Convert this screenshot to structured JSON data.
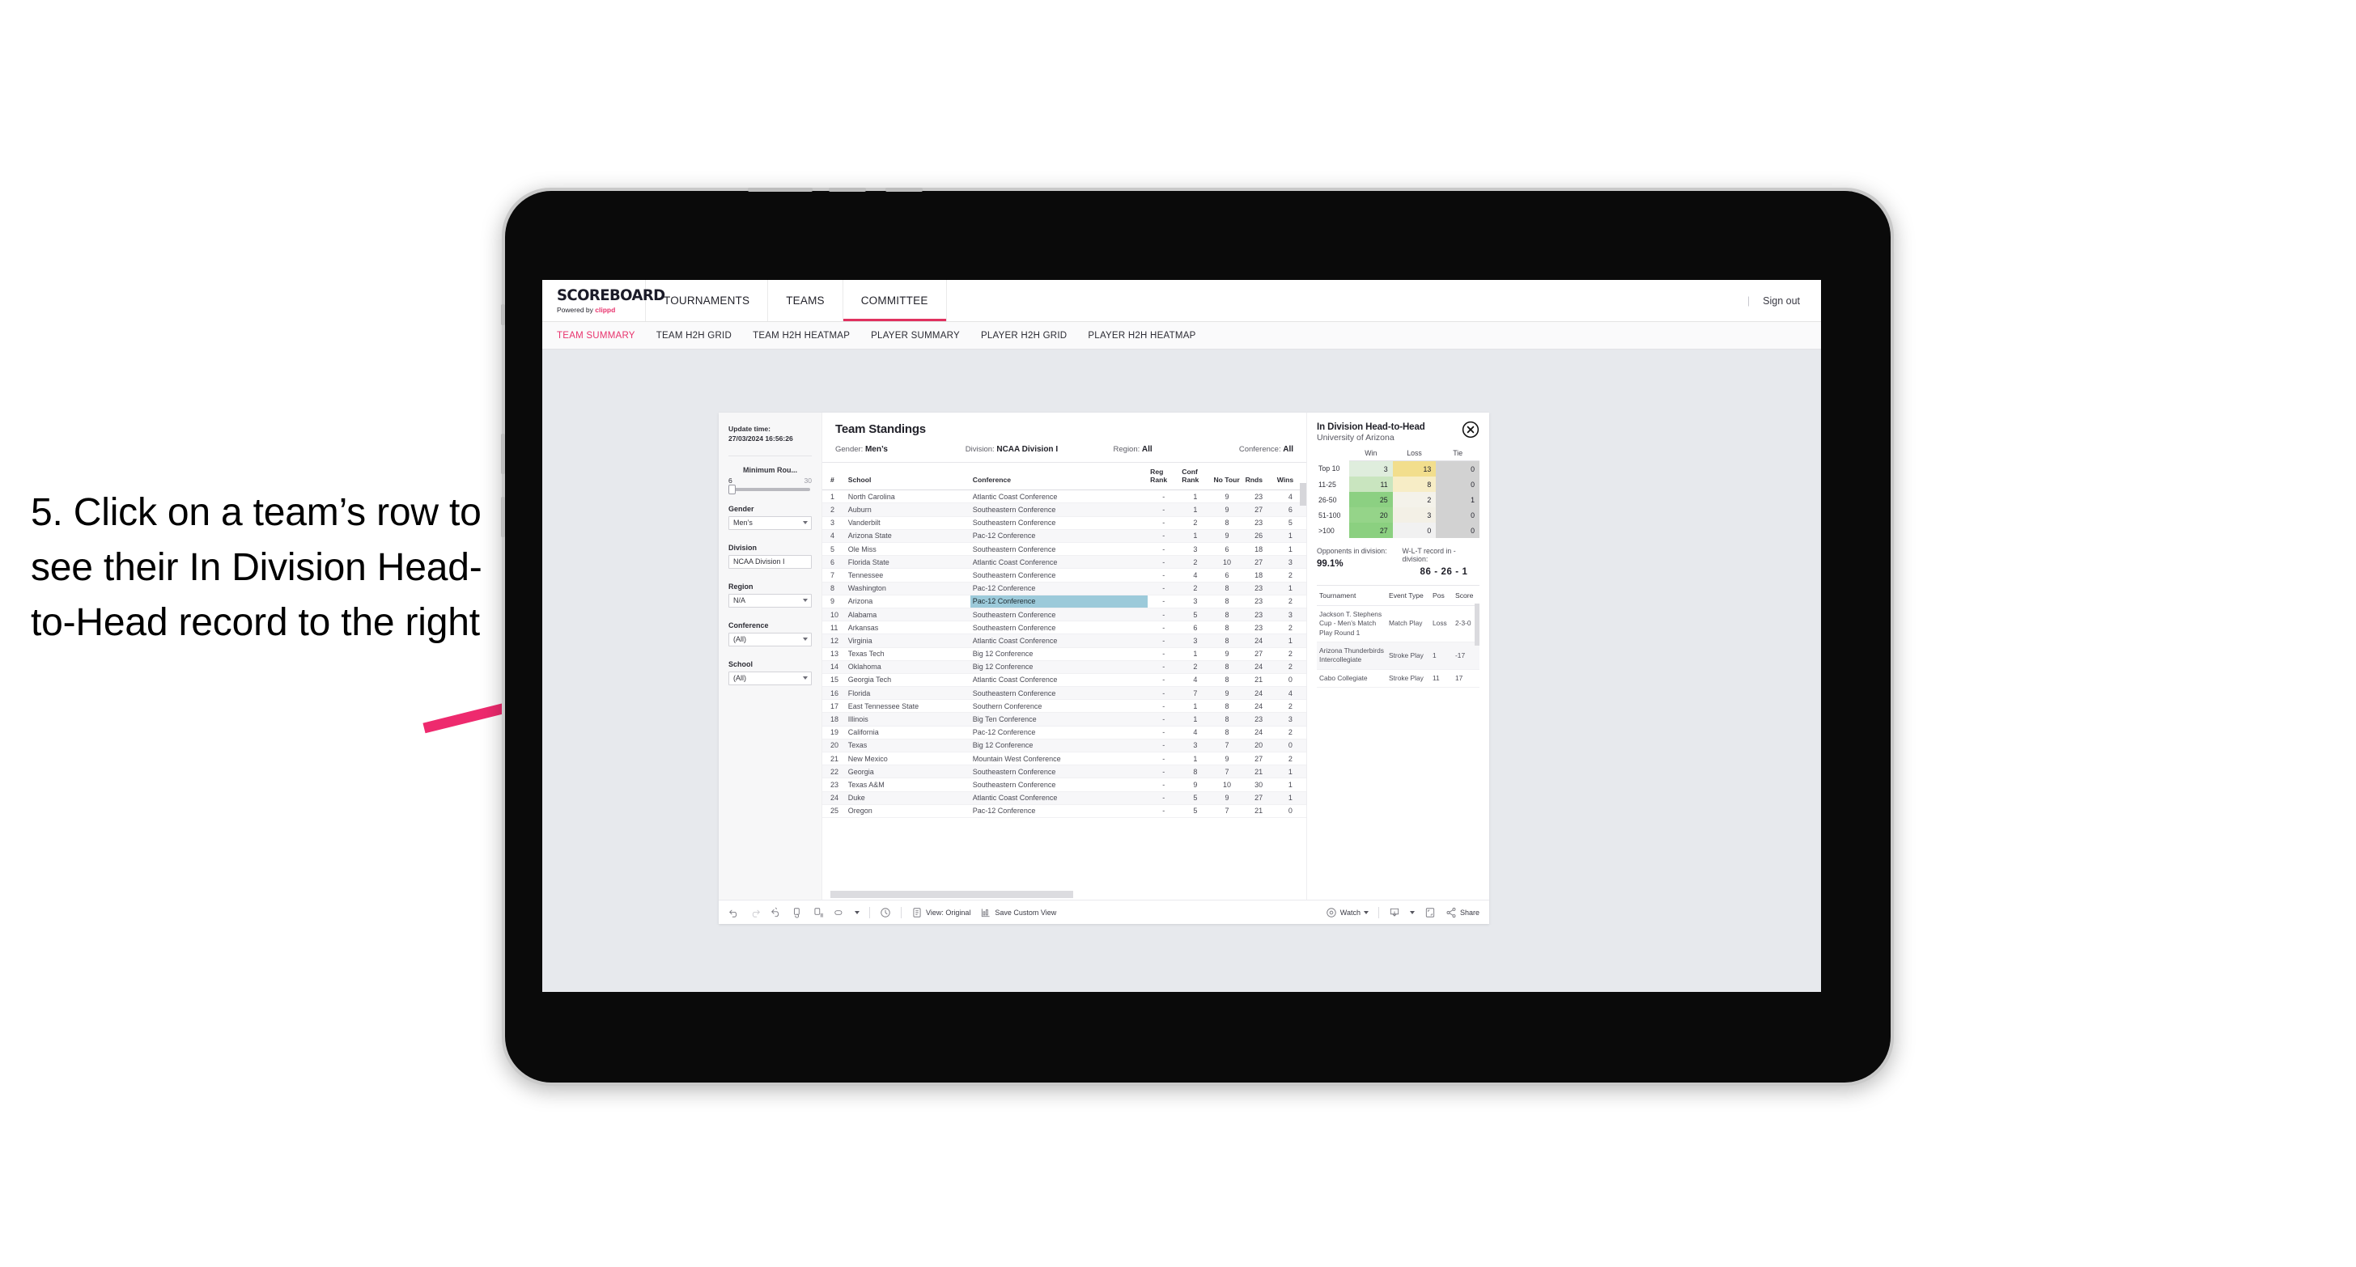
{
  "annotation": {
    "text": "5. Click on a team’s row to see their In Division Head-to-Head record to the right"
  },
  "app": {
    "brand": {
      "title": "SCOREBOARD",
      "powered_prefix": "Powered by ",
      "powered_name": "clippd"
    },
    "top_nav": [
      {
        "label": "TOURNAMENTS",
        "active": false
      },
      {
        "label": "TEAMS",
        "active": false
      },
      {
        "label": "COMMITTEE",
        "active": true
      }
    ],
    "sign_out": "Sign out",
    "divider": "|",
    "sub_tabs": [
      {
        "label": "TEAM SUMMARY",
        "active": true
      },
      {
        "label": "TEAM H2H GRID",
        "active": false
      },
      {
        "label": "TEAM H2H HEATMAP",
        "active": false
      },
      {
        "label": "PLAYER SUMMARY",
        "active": false
      },
      {
        "label": "PLAYER H2H GRID",
        "active": false
      },
      {
        "label": "PLAYER H2H HEATMAP",
        "active": false
      }
    ]
  },
  "filters": {
    "update_time_label": "Update time:",
    "update_time_value": "27/03/2024 16:56:26",
    "slider": {
      "label": "Minimum Rou...",
      "min": "6",
      "max": "30"
    },
    "selects": [
      {
        "label": "Gender",
        "value": "Men’s"
      },
      {
        "label": "Division",
        "value": "NCAA Division I"
      },
      {
        "label": "Region",
        "value": "N/A"
      },
      {
        "label": "Conference",
        "value": "(All)"
      },
      {
        "label": "School",
        "value": "(All)"
      }
    ]
  },
  "standings": {
    "title": "Team Standings",
    "meta": [
      {
        "label": "Gender: ",
        "value": "Men’s"
      },
      {
        "label": "Division: ",
        "value": "NCAA Division I"
      },
      {
        "label": "Region: ",
        "value": "All"
      },
      {
        "label": "Conference: ",
        "value": "All"
      }
    ],
    "columns": [
      "#",
      "School",
      "Conference",
      "Reg Rank",
      "Conf Rank",
      "No Tour",
      "Rnds",
      "Wins"
    ],
    "rows": [
      {
        "rank": "1",
        "school": "North Carolina",
        "conference": "Atlantic Coast Conference",
        "reg_rank": "-",
        "conf_rank": "1",
        "no_tour": "9",
        "rnds": "23",
        "wins": "4"
      },
      {
        "rank": "2",
        "school": "Auburn",
        "conference": "Southeastern Conference",
        "reg_rank": "-",
        "conf_rank": "1",
        "no_tour": "9",
        "rnds": "27",
        "wins": "6"
      },
      {
        "rank": "3",
        "school": "Vanderbilt",
        "conference": "Southeastern Conference",
        "reg_rank": "-",
        "conf_rank": "2",
        "no_tour": "8",
        "rnds": "23",
        "wins": "5"
      },
      {
        "rank": "4",
        "school": "Arizona State",
        "conference": "Pac-12 Conference",
        "reg_rank": "-",
        "conf_rank": "1",
        "no_tour": "9",
        "rnds": "26",
        "wins": "1"
      },
      {
        "rank": "5",
        "school": "Ole Miss",
        "conference": "Southeastern Conference",
        "reg_rank": "-",
        "conf_rank": "3",
        "no_tour": "6",
        "rnds": "18",
        "wins": "1"
      },
      {
        "rank": "6",
        "school": "Florida State",
        "conference": "Atlantic Coast Conference",
        "reg_rank": "-",
        "conf_rank": "2",
        "no_tour": "10",
        "rnds": "27",
        "wins": "3"
      },
      {
        "rank": "7",
        "school": "Tennessee",
        "conference": "Southeastern Conference",
        "reg_rank": "-",
        "conf_rank": "4",
        "no_tour": "6",
        "rnds": "18",
        "wins": "2"
      },
      {
        "rank": "8",
        "school": "Washington",
        "conference": "Pac-12 Conference",
        "reg_rank": "-",
        "conf_rank": "2",
        "no_tour": "8",
        "rnds": "23",
        "wins": "1"
      },
      {
        "rank": "9",
        "school": "Arizona",
        "conference": "Pac-12 Conference",
        "reg_rank": "-",
        "conf_rank": "3",
        "no_tour": "8",
        "rnds": "23",
        "wins": "2",
        "selected": true
      },
      {
        "rank": "10",
        "school": "Alabama",
        "conference": "Southeastern Conference",
        "reg_rank": "-",
        "conf_rank": "5",
        "no_tour": "8",
        "rnds": "23",
        "wins": "3"
      },
      {
        "rank": "11",
        "school": "Arkansas",
        "conference": "Southeastern Conference",
        "reg_rank": "-",
        "conf_rank": "6",
        "no_tour": "8",
        "rnds": "23",
        "wins": "2"
      },
      {
        "rank": "12",
        "school": "Virginia",
        "conference": "Atlantic Coast Conference",
        "reg_rank": "-",
        "conf_rank": "3",
        "no_tour": "8",
        "rnds": "24",
        "wins": "1"
      },
      {
        "rank": "13",
        "school": "Texas Tech",
        "conference": "Big 12 Conference",
        "reg_rank": "-",
        "conf_rank": "1",
        "no_tour": "9",
        "rnds": "27",
        "wins": "2"
      },
      {
        "rank": "14",
        "school": "Oklahoma",
        "conference": "Big 12 Conference",
        "reg_rank": "-",
        "conf_rank": "2",
        "no_tour": "8",
        "rnds": "24",
        "wins": "2"
      },
      {
        "rank": "15",
        "school": "Georgia Tech",
        "conference": "Atlantic Coast Conference",
        "reg_rank": "-",
        "conf_rank": "4",
        "no_tour": "8",
        "rnds": "21",
        "wins": "0"
      },
      {
        "rank": "16",
        "school": "Florida",
        "conference": "Southeastern Conference",
        "reg_rank": "-",
        "conf_rank": "7",
        "no_tour": "9",
        "rnds": "24",
        "wins": "4"
      },
      {
        "rank": "17",
        "school": "East Tennessee State",
        "conference": "Southern Conference",
        "reg_rank": "-",
        "conf_rank": "1",
        "no_tour": "8",
        "rnds": "24",
        "wins": "2"
      },
      {
        "rank": "18",
        "school": "Illinois",
        "conference": "Big Ten Conference",
        "reg_rank": "-",
        "conf_rank": "1",
        "no_tour": "8",
        "rnds": "23",
        "wins": "3"
      },
      {
        "rank": "19",
        "school": "California",
        "conference": "Pac-12 Conference",
        "reg_rank": "-",
        "conf_rank": "4",
        "no_tour": "8",
        "rnds": "24",
        "wins": "2"
      },
      {
        "rank": "20",
        "school": "Texas",
        "conference": "Big 12 Conference",
        "reg_rank": "-",
        "conf_rank": "3",
        "no_tour": "7",
        "rnds": "20",
        "wins": "0"
      },
      {
        "rank": "21",
        "school": "New Mexico",
        "conference": "Mountain West Conference",
        "reg_rank": "-",
        "conf_rank": "1",
        "no_tour": "9",
        "rnds": "27",
        "wins": "2"
      },
      {
        "rank": "22",
        "school": "Georgia",
        "conference": "Southeastern Conference",
        "reg_rank": "-",
        "conf_rank": "8",
        "no_tour": "7",
        "rnds": "21",
        "wins": "1"
      },
      {
        "rank": "23",
        "school": "Texas A&M",
        "conference": "Southeastern Conference",
        "reg_rank": "-",
        "conf_rank": "9",
        "no_tour": "10",
        "rnds": "30",
        "wins": "1"
      },
      {
        "rank": "24",
        "school": "Duke",
        "conference": "Atlantic Coast Conference",
        "reg_rank": "-",
        "conf_rank": "5",
        "no_tour": "9",
        "rnds": "27",
        "wins": "1"
      },
      {
        "rank": "25",
        "school": "Oregon",
        "conference": "Pac-12 Conference",
        "reg_rank": "-",
        "conf_rank": "5",
        "no_tour": "7",
        "rnds": "21",
        "wins": "0"
      }
    ]
  },
  "h2h": {
    "title": "In Division Head-to-Head",
    "subtitle": "University of Arizona",
    "close_icon": "close-circle-icon",
    "columns": [
      "",
      "Win",
      "Loss",
      "Tie"
    ],
    "rows": [
      {
        "bucket": "Top 10",
        "win": "3",
        "loss": "13",
        "tie": "0",
        "win_color": "#dfeddd",
        "loss_color": "#f2de8d"
      },
      {
        "bucket": "11-25",
        "win": "11",
        "loss": "8",
        "tie": "0",
        "win_color": "#c9e5bf",
        "loss_color": "#f7edc6"
      },
      {
        "bucket": "26-50",
        "win": "25",
        "loss": "2",
        "tie": "1",
        "win_color": "#8cd082",
        "loss_color": "#f4f2ea"
      },
      {
        "bucket": "51-100",
        "win": "20",
        "loss": "3",
        "tie": "0",
        "win_color": "#95d489",
        "loss_color": "#f3f0e6"
      },
      {
        "bucket": ">100",
        "win": "27",
        "loss": "0",
        "tie": "0",
        "win_color": "#8bd080",
        "loss_color": "#f1f1f1"
      }
    ],
    "tie_color": "#d2d2d2",
    "stats": [
      {
        "label": "Opponents in division:",
        "value": "99.1%"
      },
      {
        "label": "W-L-T record in -division:",
        "value": "86 - 26 - 1"
      }
    ],
    "tournaments": {
      "columns": [
        "Tournament",
        "Event Type",
        "Pos",
        "Score"
      ],
      "rows": [
        {
          "name": "Jackson T. Stephens Cup - Men’s Match Play Round 1",
          "type": "Match Play",
          "pos": "Loss",
          "score": "2-3-0"
        },
        {
          "name": "Arizona Thunderbirds Intercollegiate",
          "type": "Stroke Play",
          "pos": "1",
          "score": "-17"
        },
        {
          "name": "Cabo Collegiate",
          "type": "Stroke Play",
          "pos": "11",
          "score": "17"
        }
      ]
    }
  },
  "toolbar": {
    "icons": [
      "undo-icon",
      "redo-icon",
      "revert-icon",
      "refresh-data-icon",
      "pause-updates-icon",
      "highlight-icon"
    ],
    "clock_icon": "clock-icon",
    "view_label": "View: Original",
    "view_icon": "view-icon",
    "save_label": "Save Custom View",
    "save_icon": "save-view-icon",
    "watch_label": "Watch",
    "watch_icon": "watch-icon",
    "download_icon": "download-icon",
    "fullscreen_icon": "fullscreen-icon",
    "share_label": "Share",
    "share_icon": "share-icon"
  },
  "colors": {
    "accent_pink": "#e8336d",
    "selected_row": "#9ccada",
    "arrow": "#ee2a6e"
  }
}
